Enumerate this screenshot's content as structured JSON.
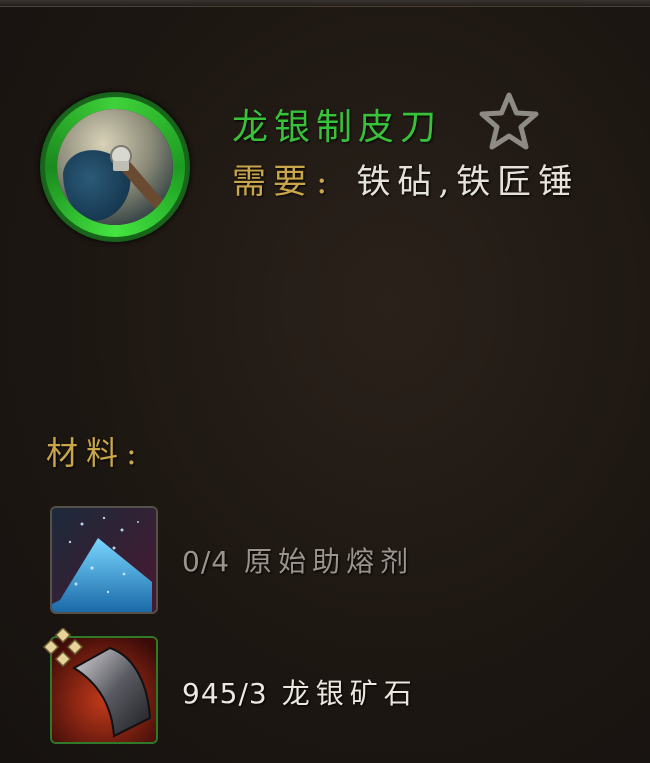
{
  "recipe": {
    "name": "龙银制皮刀",
    "icon": "skinning-knife-icon",
    "favorite_icon": "star-outline-icon",
    "requires_label": "需要",
    "requires_colon": ":",
    "requires_value": "铁砧,铁匠锤"
  },
  "materials": {
    "label": "材料:",
    "items": [
      {
        "count": "0/4",
        "name": "原始助熔剂",
        "icon": "flux-powder-icon",
        "available": false
      },
      {
        "count": "945/3",
        "name": "龙银矿石",
        "icon": "draconium-ore-icon",
        "available": true
      }
    ]
  },
  "colors": {
    "title": "#38c23a",
    "gold_label": "#c9a64a",
    "unavailable_text": "#9a948d",
    "available_text": "#ece7df"
  }
}
